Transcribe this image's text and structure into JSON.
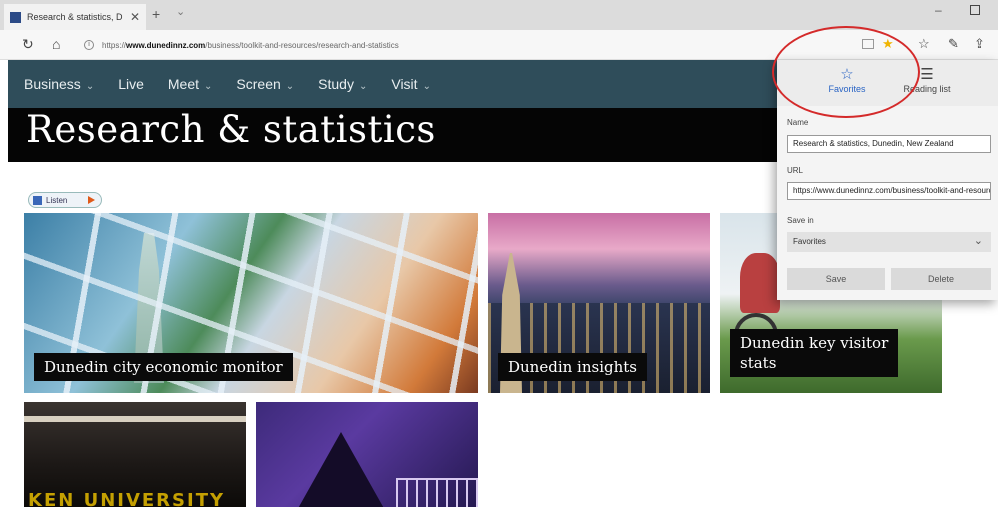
{
  "browser": {
    "tab_title": "Research & statistics, D",
    "tab_close": "✕",
    "new_tab": "+",
    "tab_menu": "⌄",
    "url_prefix": "https://",
    "url_domain": "www.dunedinnz.com",
    "url_path": "/business/toolkit-and-resources/research-and-statistics",
    "icons": [
      "back-refresh-icon",
      "home-icon",
      "info-icon",
      "reading-view-icon",
      "favorite-star-icon",
      "favorites-bar-icon",
      "pen-icon",
      "share-icon"
    ],
    "minimize": "–"
  },
  "site_nav": {
    "items": [
      {
        "label": "Business"
      },
      {
        "label": "Live"
      },
      {
        "label": "Meet"
      },
      {
        "label": "Screen"
      },
      {
        "label": "Study"
      },
      {
        "label": "Visit"
      }
    ]
  },
  "hero": {
    "title": "Research & statistics"
  },
  "listen": {
    "label": "Listen"
  },
  "cards": [
    {
      "caption": "Dunedin city economic monitor"
    },
    {
      "caption": "Dunedin insights"
    },
    {
      "caption_line1": "Dunedin key visitor",
      "caption_line2": "stats"
    },
    {
      "caption": "",
      "overlay_text": "KEN UNIVERSITY"
    },
    {
      "caption": ""
    }
  ],
  "favorites_panel": {
    "tabs": [
      {
        "label": "Favorites",
        "icon": "star-icon",
        "active": true
      },
      {
        "label": "Reading list",
        "icon": "reading-list-icon",
        "active": false
      }
    ],
    "name_label": "Name",
    "name_value": "Research & statistics, Dunedin, New Zealand",
    "url_label": "URL",
    "url_value": "https://www.dunedinnz.com/business/toolkit-and-resources/research-and-statistics",
    "save_in_label": "Save in",
    "save_in_value": "Favorites",
    "save_button": "Save",
    "delete_button": "Delete"
  },
  "colors": {
    "nav_bg": "#2f4d5a",
    "hero_bg": "#050505",
    "annotation": "#d42a2a",
    "accent_blue": "#2a64c4"
  }
}
